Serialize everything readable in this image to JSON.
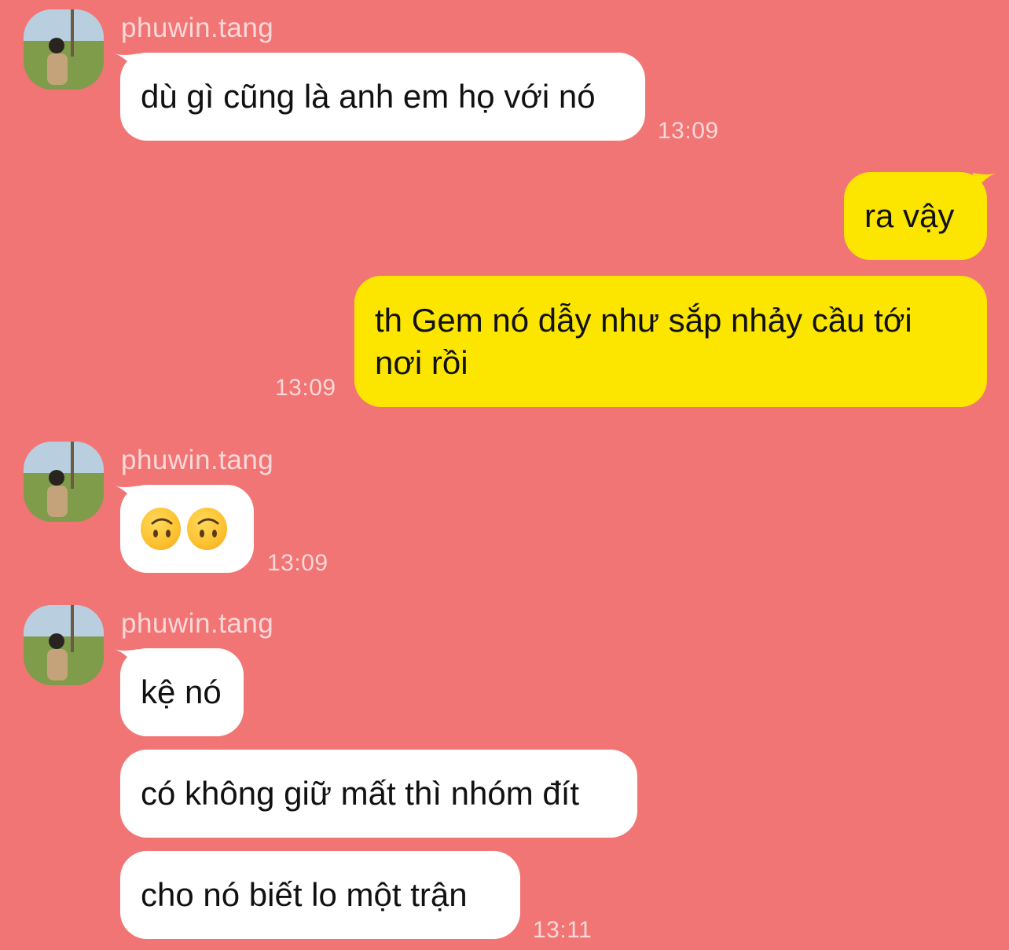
{
  "messages": [
    {
      "sender": "phuwin.tang",
      "text": "dù gì cũng là anh em họ với nó",
      "time": "13:09"
    },
    {
      "text": "ra vậy"
    },
    {
      "text_line1": "th Gem nó dẫy như sắp nhảy cầu tới",
      "text_line2": "nơi rồi",
      "time": "13:09"
    },
    {
      "sender": "phuwin.tang",
      "emoji": "upside-down-face ×2",
      "time": "13:09"
    },
    {
      "sender": "phuwin.tang",
      "text": "kệ nó"
    },
    {
      "text": "có không giữ mất thì nhóm đít"
    },
    {
      "text": "cho nó biết lo một trận",
      "time": "13:11"
    }
  ],
  "colors": {
    "background": "#f27575",
    "incoming_bubble": "#ffffff",
    "outgoing_bubble": "#fce600"
  }
}
